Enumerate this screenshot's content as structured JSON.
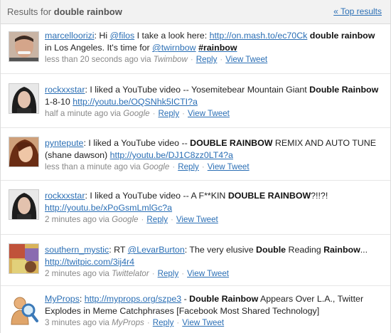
{
  "header": {
    "title_prefix": "Results for",
    "title_query": "double rainbow",
    "top_link": "« Top results"
  },
  "tweets": [
    {
      "user": "marcelloorizi",
      "parts": [
        ": Hi ",
        "@filos",
        " I take a look here: ",
        "http://on.mash.to/ec70Ck",
        " ",
        "double rainbow",
        " in Los Angeles. It's time for ",
        "@twirnbow",
        " ",
        "#rainbow"
      ],
      "time": "less than 20 seconds ago via",
      "source": "Twimbow",
      "reply": "Reply",
      "view": "View Tweet"
    },
    {
      "user": "rockxxstar",
      "parts": [
        ": I liked a YouTube video -- Yosemitebear Mountain Giant ",
        "Double Rainbow",
        " 1-8-10 ",
        "http://youtu.be/OQSNhk5ICTI?a"
      ],
      "time": "half a minute ago via",
      "source": "Google",
      "reply": "Reply",
      "view": "View Tweet"
    },
    {
      "user": "pyntepute",
      "parts": [
        ": I liked a YouTube video -- ",
        "DOUBLE RAINBOW",
        " REMIX AND AUTO TUNE (shane dawson) ",
        "http://youtu.be/DJ1C8zz0LT4?a"
      ],
      "time": "less than a minute ago via",
      "source": "Google",
      "reply": "Reply",
      "view": "View Tweet"
    },
    {
      "user": "rockxxstar",
      "parts": [
        ": I liked a YouTube video -- A F**KIN ",
        "DOUBLE RAINBOW",
        "?!!?! ",
        "http://youtu.be/xPoGsmLmlGc?a"
      ],
      "time": "2 minutes ago via",
      "source": "Google",
      "reply": "Reply",
      "view": "View Tweet"
    },
    {
      "user": "southern_mystic",
      "parts": [
        ": RT ",
        "@LevarBurton",
        ": The very elusive ",
        "Double",
        " Reading ",
        "Rainbow",
        "... ",
        "http://twitpic.com/3ij4r4"
      ],
      "time": "2 minutes ago via",
      "source": "Twittelator",
      "reply": "Reply",
      "view": "View Tweet"
    },
    {
      "user": "MyProps",
      "parts": [
        ": ",
        "http://myprops.org/szpe3",
        " - ",
        "Double Rainbow",
        " Appears Over L.A., Twitter Explodes in Meme Catchphrases [Facebook Most Shared Technology]"
      ],
      "time": "3 minutes ago via",
      "source": "MyProps",
      "reply": "Reply",
      "view": "View Tweet"
    }
  ]
}
